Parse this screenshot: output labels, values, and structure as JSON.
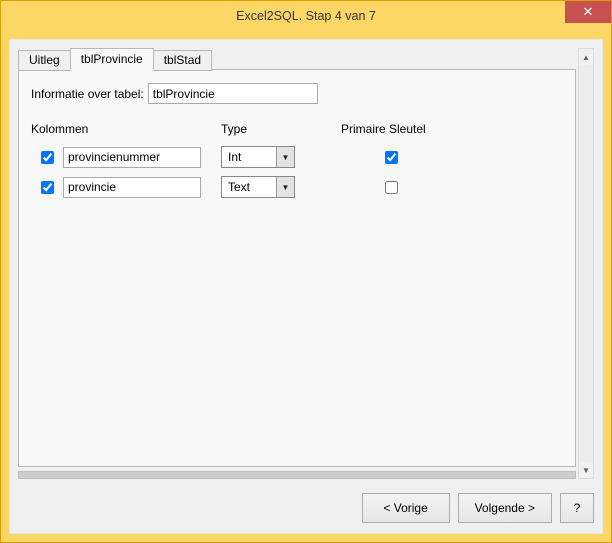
{
  "window": {
    "title": "Excel2SQL. Stap 4 van 7",
    "close_glyph": "✕"
  },
  "tabs": {
    "items": [
      {
        "label": "Uitleg",
        "active": false
      },
      {
        "label": "tblProvincie",
        "active": true
      },
      {
        "label": "tblStad",
        "active": false
      }
    ]
  },
  "info": {
    "label": "Informatie over tabel:",
    "value": "tblProvincie"
  },
  "headers": {
    "kolommen": "Kolommen",
    "type": "Type",
    "pk": "Primaire Sleutel"
  },
  "rows": [
    {
      "checked": true,
      "name": "provincienummer",
      "type": "Int",
      "pk": true
    },
    {
      "checked": true,
      "name": "provincie",
      "type": "Text",
      "pk": false
    }
  ],
  "combo": {
    "arrow": "▼"
  },
  "scroll": {
    "up": "▲",
    "down": "▼"
  },
  "footer": {
    "prev": "< Vorige",
    "next": "Volgende >",
    "help": "?"
  }
}
